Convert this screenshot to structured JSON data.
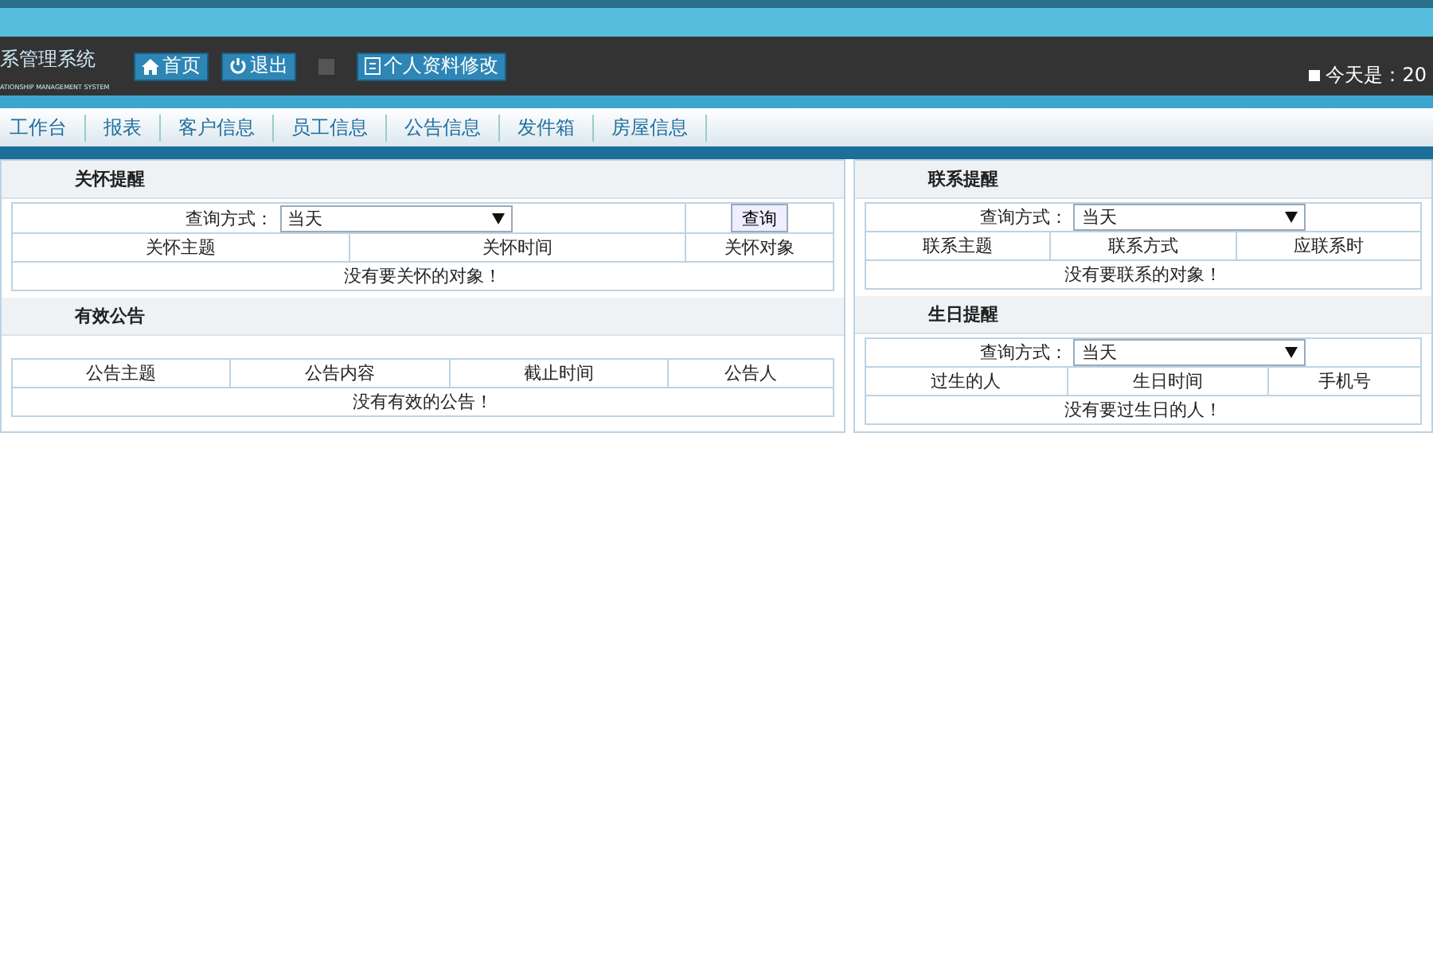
{
  "header": {
    "title": "系管理系统",
    "subtitle": "ATIONSHIP MANAGEMENT SYSTEM",
    "buttons": [
      {
        "label": "首页",
        "kind": "home"
      },
      {
        "label": "退出",
        "kind": "logout"
      },
      {
        "label": "个人资料修改",
        "kind": "profile"
      }
    ],
    "date_label": "今天是：20"
  },
  "nav": [
    {
      "label": "工作台"
    },
    {
      "label": "报表"
    },
    {
      "label": "客户信息"
    },
    {
      "label": "员工信息"
    },
    {
      "label": "公告信息"
    },
    {
      "label": "发件箱"
    },
    {
      "label": "房屋信息"
    }
  ],
  "columns": [
    [
      {
        "title": "关怀提醒",
        "query": {
          "label": "查询方式：",
          "value": "当天",
          "button": "查询"
        },
        "columns": [
          "关怀主题",
          "关怀时间",
          "关怀对象"
        ],
        "empty_message": "没有要关怀的对象！"
      },
      {
        "title": "有效公告",
        "columns": [
          "公告主题",
          "公告内容",
          "截止时间",
          "公告人"
        ],
        "empty_message": "没有有效的公告！"
      }
    ],
    [
      {
        "title": "联系提醒",
        "query": {
          "label": "查询方式：",
          "value": "当天"
        },
        "columns": [
          "联系主题",
          "联系方式",
          "应联系时"
        ],
        "empty_message": "没有要联系的对象！"
      },
      {
        "title": "生日提醒",
        "query": {
          "label": "查询方式：",
          "value": "当天"
        },
        "columns": [
          "过生的人",
          "生日时间",
          "手机号"
        ],
        "empty_message": "没有要过生日的人！"
      }
    ]
  ]
}
